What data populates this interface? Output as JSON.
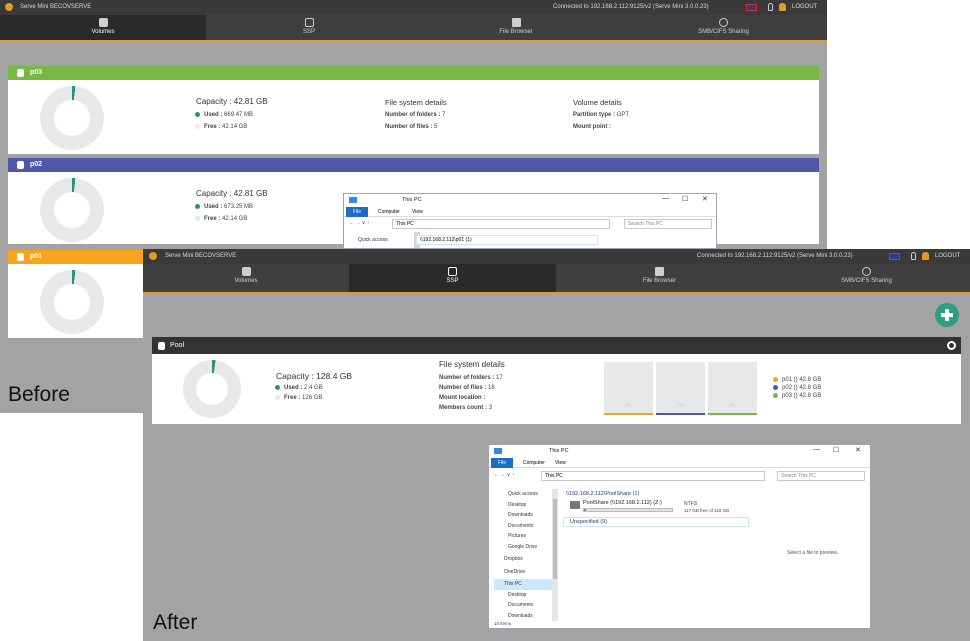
{
  "colors": {
    "green_header": "#77b845",
    "blue_header": "#4f58a6",
    "orange_header": "#f5a41c",
    "used_dot": "#2a9077",
    "free_dot": "#e6e8ea",
    "accent_line": "#e69a26",
    "add_button": "#2e9d83"
  },
  "before": {
    "label": "Before",
    "app_name": "Serve Mini BECOVSERVE",
    "connection": "Connected to 192.168.2.112:9125/v2 (Serve Mini 3.0.0.23)",
    "logout": "LOGOUT",
    "tabs": [
      {
        "label": "Volumes",
        "icon": "database-icon"
      },
      {
        "label": "SSP",
        "icon": "drive-icon"
      },
      {
        "label": "File Browser",
        "icon": "folder-icon"
      },
      {
        "label": "SMB/CIFS Sharing",
        "icon": "share-icon"
      }
    ],
    "volumes": [
      {
        "name": "p03",
        "capacity": "Capacity : 42.81 GB",
        "used_label": "Used :",
        "used_value": "669.47 MB",
        "free_label": "Free :",
        "free_value": "42.14 GB",
        "fs_title": "File system details",
        "folders_label": "Number of folders :",
        "folders_value": "7",
        "files_label": "Number of files :",
        "files_value": "5",
        "vol_title": "Volume details",
        "ptype_label": "Partition type :",
        "ptype_value": "GPT",
        "mount_label": "Mount point :",
        "mount_value": ""
      },
      {
        "name": "p02",
        "capacity": "Capacity : 42.81 GB",
        "used_label": "Used :",
        "used_value": "673.25 MB",
        "free_label": "Free :",
        "free_value": "42.14 GB"
      },
      {
        "name": "p01"
      }
    ],
    "explorer": {
      "title": "This PC",
      "ribbon": [
        "File",
        "Computer",
        "View"
      ],
      "address": "This PC",
      "search": "Search This PC",
      "quick_access": "Quick access",
      "share": "\\\\192.168.2.112\\p01 (1)"
    }
  },
  "after": {
    "label": "After",
    "app_name": "Serve Mini BECOVSERVE",
    "connection": "Connected to 192.168.2.112:9125/v2 (Serve Mini 3.0.0.23)",
    "logout": "LOGOUT",
    "tabs": [
      {
        "label": "Volumes",
        "icon": "database-icon"
      },
      {
        "label": "SSP",
        "icon": "drive-icon"
      },
      {
        "label": "File Browser",
        "icon": "folder-icon"
      },
      {
        "label": "SMB/CIFS Sharing",
        "icon": "share-icon"
      }
    ],
    "pool": {
      "name": "Pool",
      "capacity": "Capacity : 128.4 GB",
      "used_label": "Used :",
      "used_value": "2.4 GB",
      "free_label": "Free :",
      "free_value": "126 GB",
      "fs_title": "File system details",
      "folders_label": "Number of folders :",
      "folders_value": "17",
      "files_label": "Number of files :",
      "files_value": "18",
      "mount_label": "Mount location :",
      "mount_value": "",
      "members_label": "Members count :",
      "members_value": "3",
      "members": [
        {
          "label": "p01 () 42.8 GB",
          "color": "#f5a41c",
          "pct": "2%"
        },
        {
          "label": "p02 () 42.8 GB",
          "color": "#4f58a6",
          "pct": "2%"
        },
        {
          "label": "p03 () 42.8 GB",
          "color": "#77b845",
          "pct": "2%"
        }
      ]
    },
    "explorer": {
      "title": "This PC",
      "ribbon": [
        "File",
        "Computer",
        "View"
      ],
      "address": "This PC",
      "search": "Search This PC",
      "nav": [
        "Quick access",
        "Desktop",
        "Downloads",
        "Documents",
        "Pictures",
        "Google Drive",
        "Dropbox",
        "OneDrive",
        "This PC",
        "Desktop",
        "Documents",
        "Downloads"
      ],
      "group1": "\\\\192.168.2.112\\PoolShare (1)",
      "drive_name": "PoolShare (\\\\192.168.2.112) (Z:)",
      "drive_fs": "NTFS",
      "drive_free": "117 GB free of 119 GB",
      "group2": "Unspecified (9)",
      "preview": "Select a file to preview.",
      "status": "10 items"
    }
  }
}
